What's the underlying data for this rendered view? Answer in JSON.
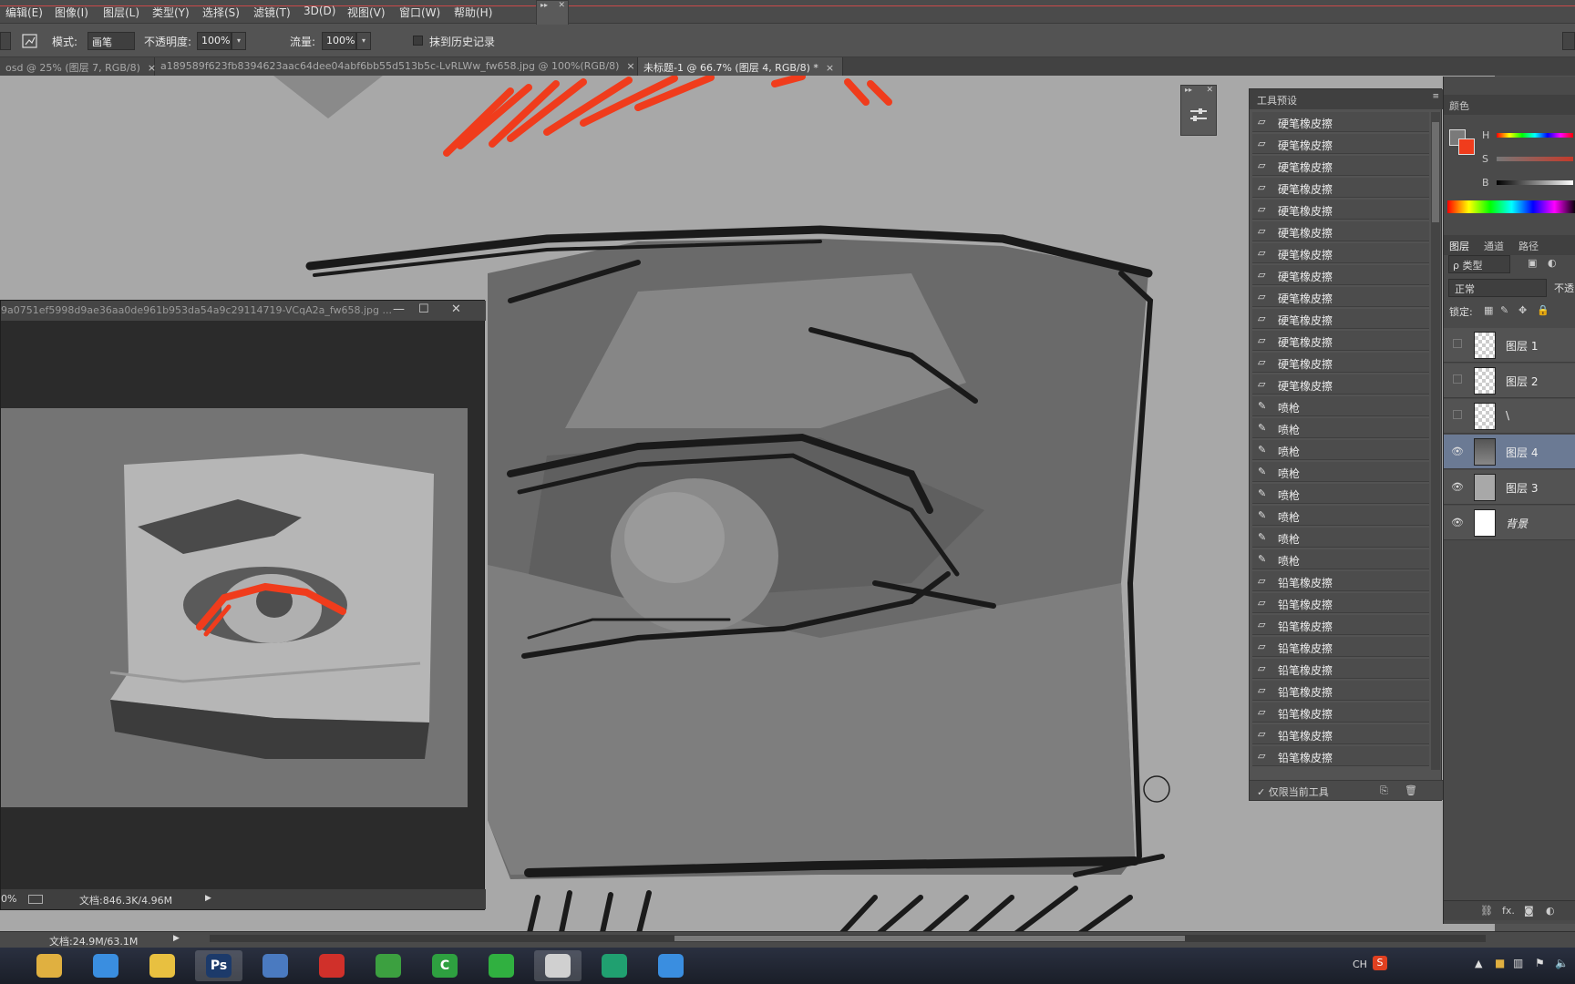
{
  "menu": {
    "items": [
      "编辑(E)",
      "图像(I)",
      "图层(L)",
      "类型(Y)",
      "选择(S)",
      "滤镜(T)",
      "3D(D)",
      "视图(V)",
      "窗口(W)",
      "帮助(H)"
    ]
  },
  "options": {
    "mode_label": "模式:",
    "mode_value": "画笔",
    "opacity_label": "不透明度:",
    "opacity_value": "100%",
    "flow_label": "流量:",
    "flow_value": "100%",
    "history_label": "抹到历史记录"
  },
  "tabs": [
    {
      "label": "osd @ 25% (图层 7, RGB/8)",
      "close": "×",
      "active": false
    },
    {
      "label": "a189589f623fb8394623aac64dee04abf6bb55d513b5c-LvRLWw_fw658.jpg @ 100%(RGB/8)",
      "close": "×",
      "active": false
    },
    {
      "label": "未标题-1 @ 66.7% (图层 4, RGB/8) *",
      "close": "×",
      "active": true
    }
  ],
  "ref_window": {
    "title": "9a0751ef5998d9ae36aa0de961b953da54a9c29114719-VCqA2a_fw658.jpg ...",
    "zoom": "0%",
    "doc_info": "文档:846.3K/4.96M"
  },
  "tool_presets": {
    "title": "工具预设",
    "items": [
      "硬笔橡皮擦",
      "硬笔橡皮擦",
      "硬笔橡皮擦",
      "硬笔橡皮擦",
      "硬笔橡皮擦",
      "硬笔橡皮擦",
      "硬笔橡皮擦",
      "硬笔橡皮擦",
      "硬笔橡皮擦",
      "硬笔橡皮擦",
      "硬笔橡皮擦",
      "硬笔橡皮擦",
      "硬笔橡皮擦",
      "喷枪",
      "喷枪",
      "喷枪",
      "喷枪",
      "喷枪",
      "喷枪",
      "喷枪",
      "喷枪",
      "铅笔橡皮擦",
      "铅笔橡皮擦",
      "铅笔橡皮擦",
      "铅笔橡皮擦",
      "铅笔橡皮擦",
      "铅笔橡皮擦",
      "铅笔橡皮擦",
      "铅笔橡皮擦",
      "铅笔橡皮擦"
    ],
    "footer_label": "仅限当前工具"
  },
  "color_panel": {
    "title": "颜色",
    "h": "H",
    "s": "S",
    "b": "B"
  },
  "layers_panel": {
    "tabs": [
      "图层",
      "通道",
      "路径"
    ],
    "filter_value": "ρ 类型",
    "blend_value": "正常",
    "opacity_label": "不透",
    "lock_label": "锁定:",
    "layers": [
      {
        "name": "图层 1",
        "visible": false,
        "selected": false
      },
      {
        "name": "图层 2",
        "visible": false,
        "selected": false
      },
      {
        "name": "\\",
        "visible": false,
        "selected": false
      },
      {
        "name": "图层 4",
        "visible": true,
        "selected": true
      },
      {
        "name": "图层 3",
        "visible": true,
        "selected": false
      },
      {
        "name": "背景",
        "visible": true,
        "selected": false
      }
    ],
    "footer_fx": "fx."
  },
  "statusbar": {
    "doc_info": "文档:24.9M/63.1M"
  },
  "taskbar": {
    "ime": "CH",
    "apps": [
      "file-explorer",
      "qq",
      "notepad",
      "photoshop",
      "browser",
      "netease-music",
      "update",
      "camtasia",
      "wechat",
      "avatar",
      "music",
      "qq2"
    ],
    "active": [
      "photoshop",
      "avatar"
    ]
  },
  "colors": {
    "accent_red": "#f03c1c",
    "panel_bg": "#535353",
    "selected_layer": "#6b7a94"
  }
}
